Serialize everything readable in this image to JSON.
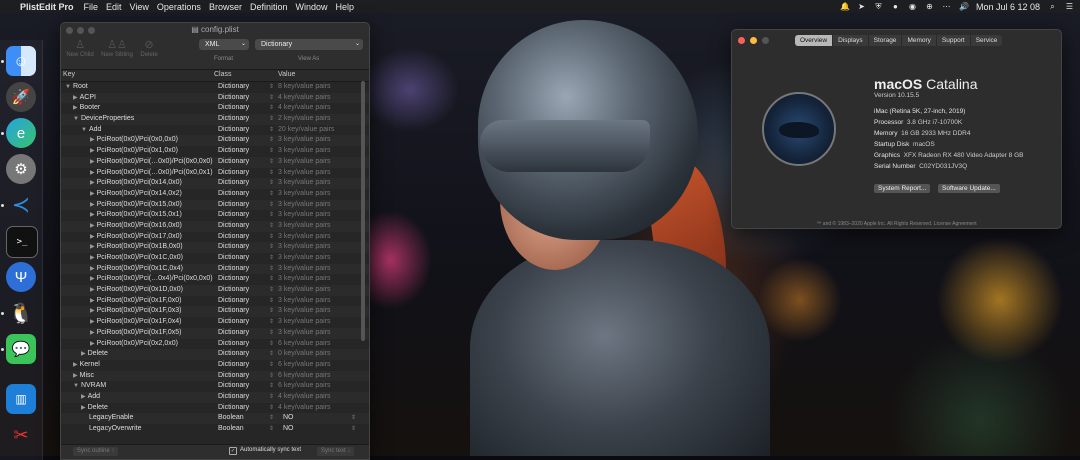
{
  "menubar": {
    "app_name": "PlistEdit Pro",
    "items": [
      "File",
      "Edit",
      "View",
      "Operations",
      "Browser",
      "Definition",
      "Window",
      "Help"
    ],
    "clock": "Mon Jul 6  12 08"
  },
  "dock": {
    "apps": [
      "finder-icon",
      "launchpad-icon",
      "edge-icon",
      "system-preferences-icon",
      "vscode-icon",
      "terminal-icon",
      "fork-icon",
      "qq-icon",
      "wechat-icon",
      "istat-icon",
      "toolbox-icon"
    ]
  },
  "plist": {
    "window_title": "config.plist",
    "toolbar": {
      "new_child": "New Child",
      "new_sibling": "New Sibling",
      "delete": "Delete",
      "format_value": "XML",
      "format_caption": "Format",
      "view_value": "Dictionary",
      "view_caption": "View As"
    },
    "columns": {
      "key": "Key",
      "class": "Class",
      "value": "Value"
    },
    "rows": [
      {
        "key": "Root",
        "class": "Dictionary",
        "value": "8 key/value pairs",
        "level": 0,
        "tri": "▼"
      },
      {
        "key": "ACPI",
        "class": "Dictionary",
        "value": "4 key/value pairs",
        "level": 1,
        "tri": "▶"
      },
      {
        "key": "Booter",
        "class": "Dictionary",
        "value": "4 key/value pairs",
        "level": 1,
        "tri": "▶"
      },
      {
        "key": "DeviceProperties",
        "class": "Dictionary",
        "value": "2 key/value pairs",
        "level": 1,
        "tri": "▼"
      },
      {
        "key": "Add",
        "class": "Dictionary",
        "value": "20 key/value pairs",
        "level": 2,
        "tri": "▼"
      },
      {
        "key": "PciRoot(0x0)/Pci(0x0,0x0)",
        "class": "Dictionary",
        "value": "3 key/value pairs",
        "level": 3,
        "tri": "▶"
      },
      {
        "key": "PciRoot(0x0)/Pci(0x1,0x0)",
        "class": "Dictionary",
        "value": "3 key/value pairs",
        "level": 3,
        "tri": "▶"
      },
      {
        "key": "PciRoot(0x0)/Pci(…0x0)/Pci(0x0,0x0)",
        "class": "Dictionary",
        "value": "3 key/value pairs",
        "level": 3,
        "tri": "▶"
      },
      {
        "key": "PciRoot(0x0)/Pci(…0x0)/Pci(0x0,0x1)",
        "class": "Dictionary",
        "value": "3 key/value pairs",
        "level": 3,
        "tri": "▶"
      },
      {
        "key": "PciRoot(0x0)/Pci(0x14,0x0)",
        "class": "Dictionary",
        "value": "3 key/value pairs",
        "level": 3,
        "tri": "▶"
      },
      {
        "key": "PciRoot(0x0)/Pci(0x14,0x2)",
        "class": "Dictionary",
        "value": "3 key/value pairs",
        "level": 3,
        "tri": "▶"
      },
      {
        "key": "PciRoot(0x0)/Pci(0x15,0x0)",
        "class": "Dictionary",
        "value": "3 key/value pairs",
        "level": 3,
        "tri": "▶"
      },
      {
        "key": "PciRoot(0x0)/Pci(0x15,0x1)",
        "class": "Dictionary",
        "value": "3 key/value pairs",
        "level": 3,
        "tri": "▶"
      },
      {
        "key": "PciRoot(0x0)/Pci(0x16,0x0)",
        "class": "Dictionary",
        "value": "3 key/value pairs",
        "level": 3,
        "tri": "▶"
      },
      {
        "key": "PciRoot(0x0)/Pci(0x17,0x0)",
        "class": "Dictionary",
        "value": "3 key/value pairs",
        "level": 3,
        "tri": "▶"
      },
      {
        "key": "PciRoot(0x0)/Pci(0x1B,0x0)",
        "class": "Dictionary",
        "value": "3 key/value pairs",
        "level": 3,
        "tri": "▶"
      },
      {
        "key": "PciRoot(0x0)/Pci(0x1C,0x0)",
        "class": "Dictionary",
        "value": "3 key/value pairs",
        "level": 3,
        "tri": "▶"
      },
      {
        "key": "PciRoot(0x0)/Pci(0x1C,0x4)",
        "class": "Dictionary",
        "value": "3 key/value pairs",
        "level": 3,
        "tri": "▶"
      },
      {
        "key": "PciRoot(0x0)/Pci(…0x4)/Pci(0x0,0x0)",
        "class": "Dictionary",
        "value": "3 key/value pairs",
        "level": 3,
        "tri": "▶"
      },
      {
        "key": "PciRoot(0x0)/Pci(0x1D,0x0)",
        "class": "Dictionary",
        "value": "3 key/value pairs",
        "level": 3,
        "tri": "▶"
      },
      {
        "key": "PciRoot(0x0)/Pci(0x1F,0x0)",
        "class": "Dictionary",
        "value": "3 key/value pairs",
        "level": 3,
        "tri": "▶"
      },
      {
        "key": "PciRoot(0x0)/Pci(0x1F,0x3)",
        "class": "Dictionary",
        "value": "3 key/value pairs",
        "level": 3,
        "tri": "▶"
      },
      {
        "key": "PciRoot(0x0)/Pci(0x1F,0x4)",
        "class": "Dictionary",
        "value": "3 key/value pairs",
        "level": 3,
        "tri": "▶"
      },
      {
        "key": "PciRoot(0x0)/Pci(0x1F,0x5)",
        "class": "Dictionary",
        "value": "3 key/value pairs",
        "level": 3,
        "tri": "▶"
      },
      {
        "key": "PciRoot(0x0)/Pci(0x2,0x0)",
        "class": "Dictionary",
        "value": "6 key/value pairs",
        "level": 3,
        "tri": "▶"
      },
      {
        "key": "Delete",
        "class": "Dictionary",
        "value": "0 key/value pairs",
        "level": 2,
        "tri": "▶"
      },
      {
        "key": "Kernel",
        "class": "Dictionary",
        "value": "6 key/value pairs",
        "level": 1,
        "tri": "▶"
      },
      {
        "key": "Misc",
        "class": "Dictionary",
        "value": "6 key/value pairs",
        "level": 1,
        "tri": "▶"
      },
      {
        "key": "NVRAM",
        "class": "Dictionary",
        "value": "6 key/value pairs",
        "level": 1,
        "tri": "▼"
      },
      {
        "key": "Add",
        "class": "Dictionary",
        "value": "4 key/value pairs",
        "level": 2,
        "tri": "▶"
      },
      {
        "key": "Delete",
        "class": "Dictionary",
        "value": "4 key/value pairs",
        "level": 2,
        "tri": "▶"
      },
      {
        "key": "LegacyEnable",
        "class": "Boolean",
        "value": "NO",
        "level": 2,
        "tri": "",
        "bool": true
      },
      {
        "key": "LegacyOverwrite",
        "class": "Boolean",
        "value": "NO",
        "level": 2,
        "tri": "",
        "bool": true
      }
    ],
    "bottom": {
      "sync_outline": "Sync outline ↑",
      "auto_sync": "Automatically sync text",
      "sync_text": "Sync text ↓"
    }
  },
  "about": {
    "tabs": [
      "Overview",
      "Displays",
      "Storage",
      "Memory",
      "Support",
      "Service"
    ],
    "active_tab": "Overview",
    "os_name_bold": "macOS",
    "os_name_rest": " Catalina",
    "version": "Version 10.15.5",
    "specs": [
      {
        "k": "iMac (Retina 5K, 27-inch, 2019)",
        "v": ""
      },
      {
        "k": "Processor",
        "v": "3.8 GHz i7-10700K"
      },
      {
        "k": "Memory",
        "v": "16 GB 2933 MHz DDR4"
      },
      {
        "k": "Startup Disk",
        "v": "macOS"
      },
      {
        "k": "Graphics",
        "v": "XFX Radeon RX 480 Video Adapter 8 GB"
      },
      {
        "k": "Serial Number",
        "v": "C02YD031JV3Q"
      }
    ],
    "btn_report": "System Report...",
    "btn_update": "Software Update...",
    "footer": "™ and © 1983–2020 Apple Inc. All Rights Reserved. License Agreement"
  }
}
